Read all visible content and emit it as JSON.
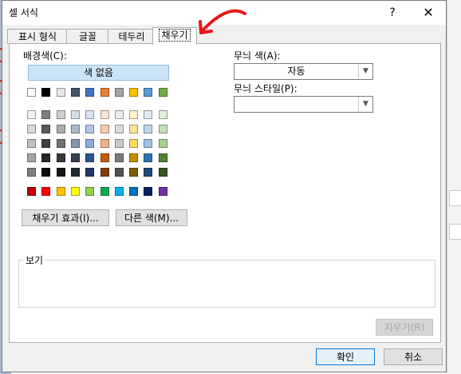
{
  "window": {
    "title": "셀 서식",
    "help_icon": "?",
    "close_icon": "✕"
  },
  "tabs": [
    {
      "label": "표시 형식"
    },
    {
      "label": "글꼴"
    },
    {
      "label": "테두리"
    },
    {
      "label": "채우기"
    }
  ],
  "fill": {
    "background_color_label": "배경색(C):",
    "no_color_label": "색 없음",
    "fill_effects_button": "채우기 효과(I)...",
    "more_colors_button": "다른 색(M)..."
  },
  "pattern": {
    "color_label": "무늬 색(A):",
    "color_value": "자동",
    "style_label": "무늬 스타일(P):",
    "style_value": ""
  },
  "preview": {
    "label": "보기"
  },
  "clear_button": "지우기(R)",
  "ok_button": "확인",
  "cancel_button": "취소",
  "palette": {
    "theme_row": [
      "#ffffff",
      "#000000",
      "#e7e6e6",
      "#44546a",
      "#4472c4",
      "#ed7d31",
      "#a5a5a5",
      "#ffc000",
      "#5b9bd5",
      "#70ad47"
    ],
    "tint_rows": [
      [
        "#f2f2f2",
        "#7f7f7f",
        "#d0cece",
        "#d6dce4",
        "#d9e2f3",
        "#fbe5d5",
        "#ededed",
        "#fff2cc",
        "#deebf6",
        "#e2efd9"
      ],
      [
        "#d8d8d8",
        "#595959",
        "#aeabab",
        "#adb9ca",
        "#b4c6e7",
        "#f7cbac",
        "#dbdbdb",
        "#fee599",
        "#bdd7ee",
        "#c5e0b3"
      ],
      [
        "#bfbfbf",
        "#3f3f3f",
        "#757070",
        "#8496b0",
        "#8eaadb",
        "#f4b183",
        "#c9c9c9",
        "#ffd965",
        "#9dc3e6",
        "#a8d08d"
      ],
      [
        "#a5a5a5",
        "#262626",
        "#3a3838",
        "#323f4f",
        "#2f5496",
        "#c55a11",
        "#7b7b7b",
        "#bf9000",
        "#2e75b5",
        "#538135"
      ],
      [
        "#7f7f7f",
        "#0c0c0c",
        "#161616",
        "#222a35",
        "#1f3864",
        "#833c0b",
        "#525252",
        "#7f6000",
        "#1e4e79",
        "#375623"
      ]
    ],
    "standard_row": [
      "#c00000",
      "#ff0000",
      "#ffc000",
      "#ffff00",
      "#92d050",
      "#00b050",
      "#00b0f0",
      "#0070c0",
      "#002060",
      "#7030a0"
    ]
  }
}
